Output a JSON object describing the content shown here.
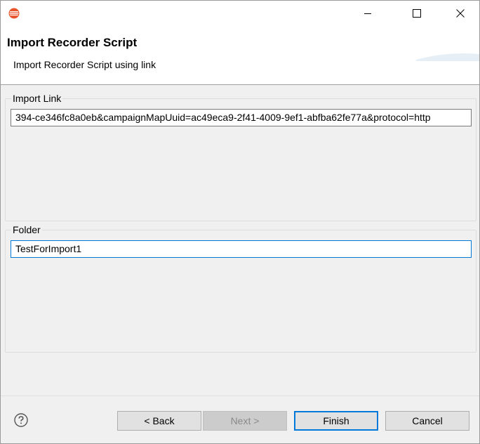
{
  "window": {
    "icon": "eclipse-app-icon",
    "controls": [
      "minimize-icon",
      "maximize-icon",
      "close-icon"
    ]
  },
  "banner": {
    "title": "Import Recorder Script",
    "subtitle": "Import Recorder Script using link"
  },
  "import_link": {
    "label": "Import Link",
    "value": "394-ce346fc8a0eb&campaignMapUuid=ac49eca9-2f41-4009-9ef1-abfba62fe77a&protocol=http"
  },
  "folder": {
    "label": "Folder",
    "value": "TestForImport1"
  },
  "buttons": {
    "help_icon": "help-icon",
    "back": "< Back",
    "next": "Next >",
    "finish": "Finish",
    "cancel": "Cancel"
  },
  "colors": {
    "focus": "#0078d7",
    "app_icon": "#e8542b"
  }
}
